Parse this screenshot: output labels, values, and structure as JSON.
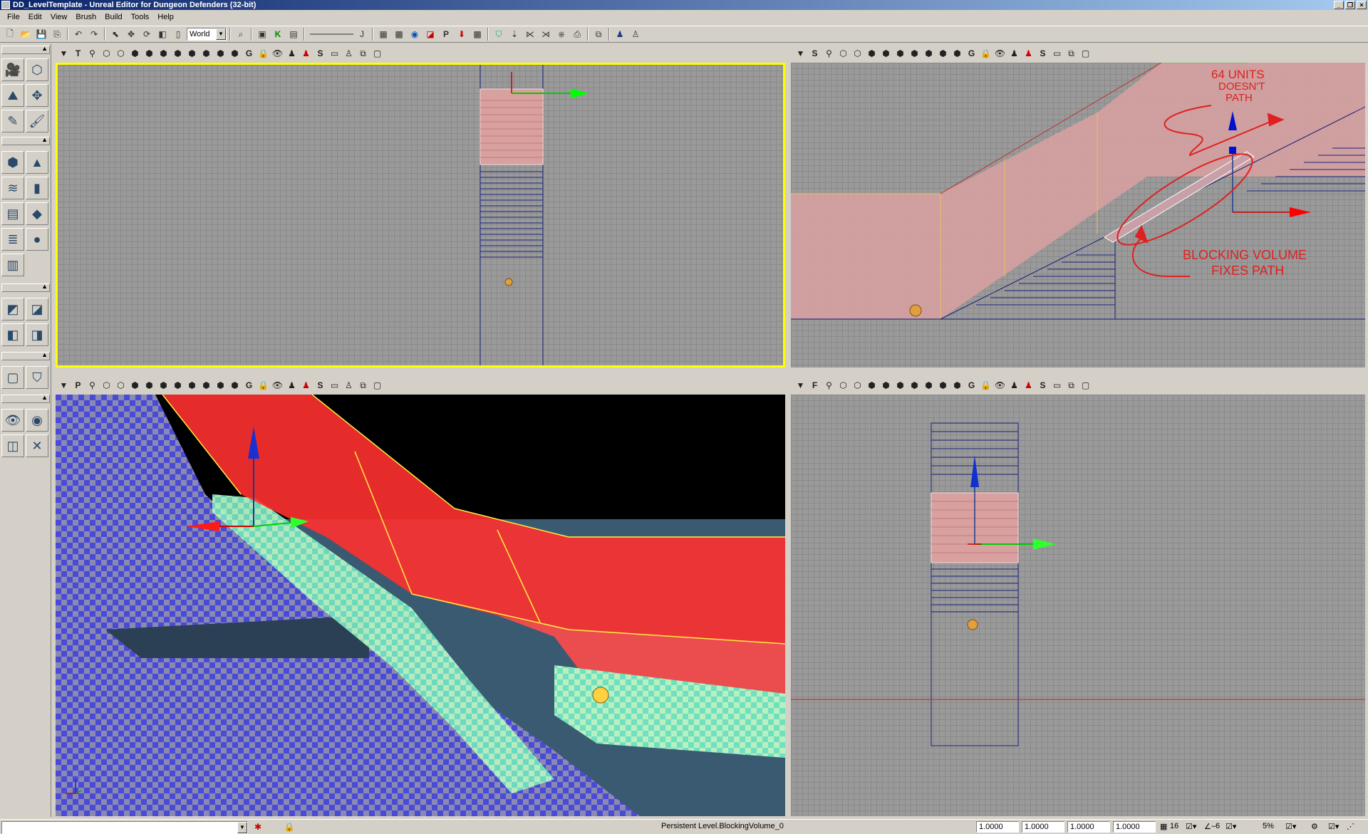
{
  "window": {
    "title": "DD_LevelTemplate - Unreal Editor for Dungeon Defenders (32-bit)"
  },
  "menu": [
    "File",
    "Edit",
    "View",
    "Brush",
    "Build",
    "Tools",
    "Help"
  ],
  "toolbar": {
    "coord_system": "World"
  },
  "viewports": {
    "top": {
      "mode_letter": "T"
    },
    "side": {
      "mode_letter": "S",
      "annotation_top": [
        "64 UNITS",
        "DOESN'T",
        "PATH"
      ],
      "annotation_bottom": [
        "BLOCKING VOLUME",
        "FIXES PATH"
      ]
    },
    "perspective": {
      "mode_letter": "P",
      "axis_z": "Z"
    },
    "front": {
      "mode_letter": "F"
    }
  },
  "toolbar_glyph": {
    "g": "G",
    "s": "S",
    "j": "J"
  },
  "statusbar": {
    "selection": "Persistent Level.BlockingVolume_0",
    "drag_grid_1": "1.0000",
    "drag_grid_2": "1.0000",
    "drag_grid_3": "1.0000",
    "drag_grid_4": "1.0000",
    "grid_size": "16",
    "rot_snap": "6",
    "scale_snap": "5%"
  },
  "colors": {
    "annotation": "#e02020",
    "selection_border": "#ffff00",
    "volume_fill": "#d9a0a0"
  }
}
